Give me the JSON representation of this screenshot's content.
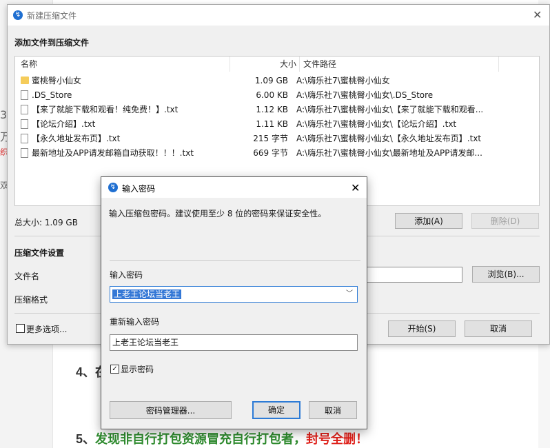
{
  "background": {
    "left_fragments": [
      "36",
      "万",
      "织",
      "双"
    ],
    "heading4": "4、在",
    "heading5": {
      "num": "5、",
      "green_text": "发现非自行打包资源冒充自行打包者，",
      "red_text": "封号全删！"
    }
  },
  "window": {
    "title": "新建压缩文件",
    "close_glyph": "✕",
    "section_add": "添加文件到压缩文件",
    "columns": {
      "name": "名称",
      "size": "大小",
      "path": "文件路径"
    },
    "files": [
      {
        "icon": "folder-icon",
        "name": "蜜桃臀小仙女",
        "size": "1.09 GB",
        "path": "A:\\嗨乐社7\\蜜桃臀小仙女"
      },
      {
        "icon": "file-icon",
        "name": ".DS_Store",
        "size": "6.00 KB",
        "path": "A:\\嗨乐社7\\蜜桃臀小仙女\\.DS_Store"
      },
      {
        "icon": "file-icon",
        "name": "【来了就能下载和观看！纯免费！】.txt",
        "size": "1.12 KB",
        "path": "A:\\嗨乐社7\\蜜桃臀小仙女\\【来了就能下载和观看..."
      },
      {
        "icon": "file-icon",
        "name": "【论坛介绍】.txt",
        "size": "1.11 KB",
        "path": "A:\\嗨乐社7\\蜜桃臀小仙女\\【论坛介绍】.txt"
      },
      {
        "icon": "file-icon",
        "name": "【永久地址发布页】.txt",
        "size": "215 字节",
        "path": "A:\\嗨乐社7\\蜜桃臀小仙女\\【永久地址发布页】.txt"
      },
      {
        "icon": "file-icon",
        "name": "最新地址及APP请发邮箱自动获取！！！.txt",
        "size": "669 字节",
        "path": "A:\\嗨乐社7\\蜜桃臀小仙女\\最新地址及APP请发邮..."
      }
    ],
    "total_size": "总大小: 1.09 GB",
    "add_button": "添加(A)",
    "delete_button": "删除(D)",
    "section_settings": "压缩文件设置",
    "filename_label": "文件名",
    "format_label": "压缩格式",
    "browse_button": "浏览(B)...",
    "more_options": "更多选项...",
    "start_button": "开始(S)",
    "cancel_button": "取消"
  },
  "dialog": {
    "title": "输入密码",
    "close_glyph": "✕",
    "description": "输入压缩包密码。建议使用至少 8 位的密码来保证安全性。",
    "password_label": "输入密码",
    "password_value": "上老王论坛当老王",
    "repeat_label": "重新输入密码",
    "repeat_value": "上老王论坛当老王",
    "show_password_label": "显示密码",
    "show_password_checked": true,
    "manager_button": "密码管理器...",
    "ok_button": "确定",
    "cancel_button": "取消"
  },
  "colors": {
    "accent": "#2d7bd6",
    "selection": "#3478d6",
    "folder": "#f5cc5a"
  }
}
